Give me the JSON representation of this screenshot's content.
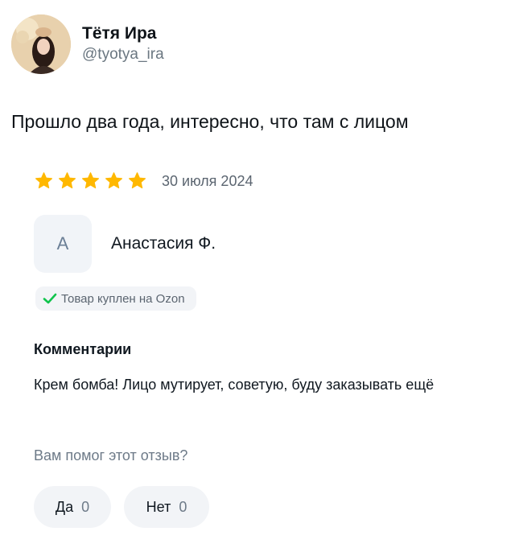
{
  "tweet": {
    "display_name": "Тётя Ира",
    "handle": "@tyotya_ira",
    "text": "Прошло два года, интересно, что там с лицом"
  },
  "review": {
    "stars": 5,
    "star_color": "#ffb800",
    "date": "30 июля 2024",
    "author_initial": "А",
    "author_name": "Анастасия Ф.",
    "purchased_badge": "Товар куплен на Ozon",
    "badge_icon": "check-icon",
    "badge_icon_color": "#10c44c",
    "comments_heading": "Комментарии",
    "comment": "Крем бомба! Лицо мутирует, советую, буду заказывать ещё",
    "helpful_question": "Вам помог этот отзыв?",
    "yes_label": "Да",
    "yes_count": "0",
    "no_label": "Нет",
    "no_count": "0"
  }
}
